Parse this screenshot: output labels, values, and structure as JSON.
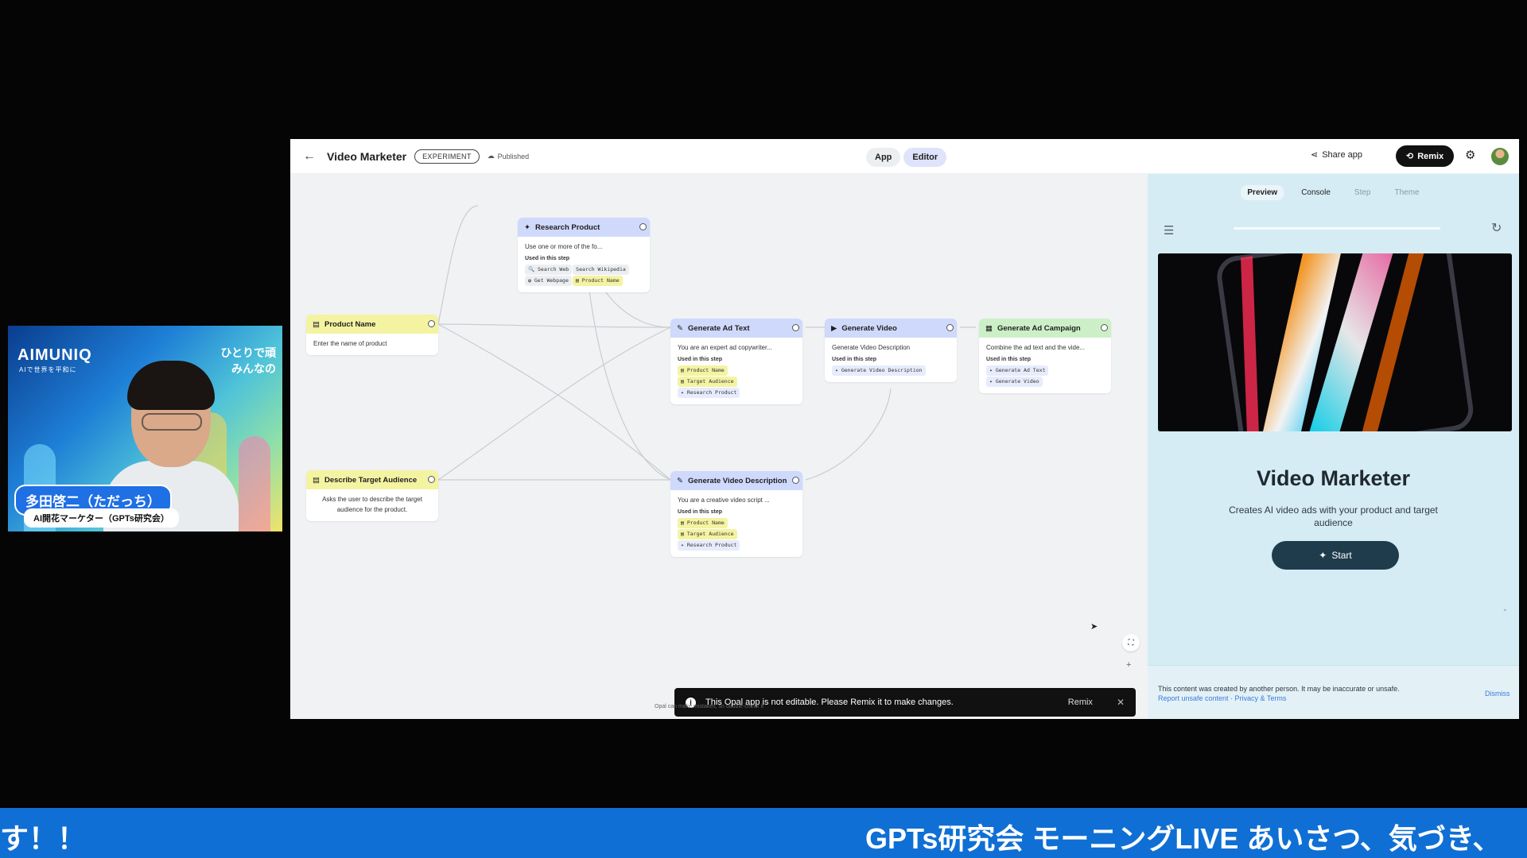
{
  "webcam": {
    "brand": "AIMUNIQ",
    "brand_sub": "AIで世界を平和に",
    "tagline_1": "ひとりで頑",
    "tagline_2": "みんなの",
    "name": "多田啓二（ただっち）",
    "role": "AI開花マーケター（GPTs研究会）"
  },
  "topbar": {
    "title": "Video Marketer",
    "badge": "EXPERIMENT",
    "status": "Published",
    "mode_app": "App",
    "mode_editor": "Editor",
    "share": "Share app",
    "remix": "Remix"
  },
  "nodes": {
    "research": {
      "title": "Research Product",
      "desc": "Use one or more of the fo...",
      "used": "Used in this step",
      "chips": [
        "Search Web",
        "Search Wikipedia",
        "Get Webpage",
        "Product Name"
      ]
    },
    "product_name": {
      "title": "Product Name",
      "desc": "Enter the name of product"
    },
    "target": {
      "title": "Describe Target Audience",
      "desc": "Asks the user to describe the target audience for the product."
    },
    "ad_text": {
      "title": "Generate Ad Text",
      "desc": "You are an expert ad copywriter...",
      "used": "Used in this step",
      "chips": [
        "Product Name",
        "Target Audience",
        "Research Product"
      ]
    },
    "video": {
      "title": "Generate Video",
      "desc": "Generate Video Description",
      "used": "Used in this step",
      "chips": [
        "Generate Video Description"
      ]
    },
    "campaign": {
      "title": "Generate Ad Campaign",
      "desc": "Combine the ad text and the vide...",
      "used": "Used in this step",
      "chips": [
        "Generate Ad Text",
        "Generate Video"
      ]
    },
    "video_desc": {
      "title": "Generate Video Description",
      "desc": "You are a creative video script ...",
      "used": "Used in this step",
      "chips": [
        "Product Name",
        "Target Audience",
        "Research Product"
      ]
    }
  },
  "toast": {
    "message": "This Opal app is not editable. Please Remix it to make changes.",
    "action": "Remix"
  },
  "canvas": {
    "disclaimer": "Opal can make mistakes, so double-check it"
  },
  "panel": {
    "tabs": [
      "Preview",
      "Console",
      "Step",
      "Theme"
    ],
    "app_title": "Video Marketer",
    "app_desc": "Creates AI video ads with your product and target audience",
    "start": "Start",
    "footer_text": "This content was created by another person. It may be inaccurate or unsafe.",
    "footer_links": "Report unsafe content · Privacy & Terms",
    "dismiss": "Dismiss"
  },
  "ticker": {
    "left": "す！！",
    "right": "GPTs研究会 モーニングLIVE あいさつ、気づき、"
  }
}
